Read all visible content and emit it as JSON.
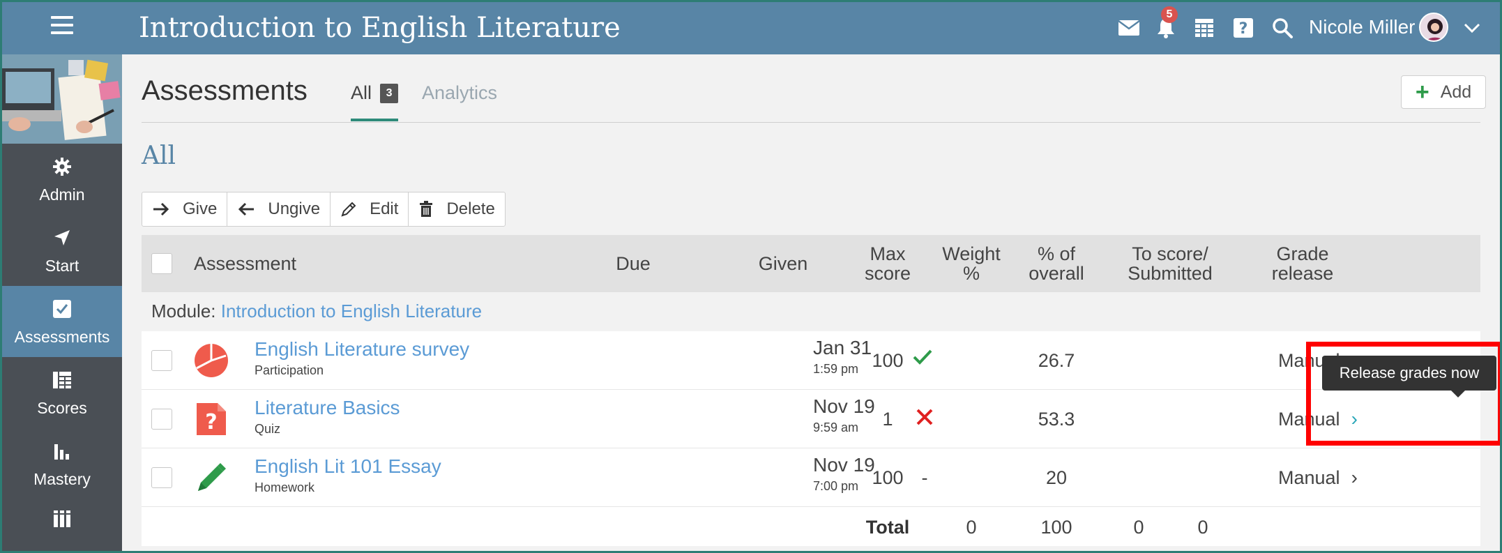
{
  "header": {
    "course_title": "Introduction to English Literature",
    "notification_count": "5",
    "user_name": "Nicole Miller"
  },
  "sidebar": {
    "items": [
      {
        "label": "Admin",
        "icon": "gear-icon"
      },
      {
        "label": "Start",
        "icon": "navigation-arrow-icon"
      },
      {
        "label": "Assessments",
        "icon": "checkbox-icon",
        "active": true
      },
      {
        "label": "Scores",
        "icon": "gradebook-icon"
      },
      {
        "label": "Mastery",
        "icon": "bar-chart-icon"
      }
    ]
  },
  "page": {
    "title": "Assessments",
    "tabs": [
      {
        "label": "All",
        "count": "3",
        "active": true
      },
      {
        "label": "Analytics"
      }
    ],
    "add_label": "Add",
    "section_heading": "All"
  },
  "toolbar": {
    "give": "Give",
    "ungive": "Ungive",
    "edit": "Edit",
    "delete": "Delete"
  },
  "table": {
    "columns": {
      "assessment": "Assessment",
      "due": "Due",
      "given": "Given",
      "max_score_1": "Max",
      "max_score_2": "score",
      "weight_1": "Weight",
      "weight_2": "%",
      "overall_1": "% of",
      "overall_2": "overall",
      "to_score_1": "To score/",
      "to_score_2": "Submitted",
      "grade_1": "Grade",
      "grade_2": "release"
    },
    "module_prefix": "Module:",
    "module_name": "Introduction to English Literature",
    "rows": [
      {
        "title": "English Literature survey",
        "type": "Participation",
        "due_date": "Jan 31",
        "due_time": "1:59 pm",
        "given": "check",
        "max_score": "100",
        "weight": "",
        "overall": "26.7",
        "grade_release": "Manual"
      },
      {
        "title": "Literature Basics",
        "type": "Quiz",
        "due_date": "Nov 19",
        "due_time": "9:59 am",
        "given": "cross",
        "max_score": "1",
        "weight": "",
        "overall": "53.3",
        "grade_release": "Manual"
      },
      {
        "title": "English Lit 101 Essay",
        "type": "Homework",
        "due_date": "Nov 19",
        "due_time": "7:00 pm",
        "given": "-",
        "max_score": "100",
        "weight": "",
        "overall": "20",
        "grade_release": "Manual"
      }
    ],
    "total": {
      "label": "Total",
      "weight": "0",
      "overall": "100",
      "to_score": "0",
      "submitted": "0"
    }
  },
  "tooltip": {
    "text": "Release grades now"
  },
  "colors": {
    "topbar": "#5885a6",
    "sidebar": "#4a4f55",
    "link": "#5b9bd5",
    "check": "#2e9b4a",
    "cross": "#e02020",
    "highlight": "#ff0000",
    "icon_red": "#ef5b4c"
  }
}
